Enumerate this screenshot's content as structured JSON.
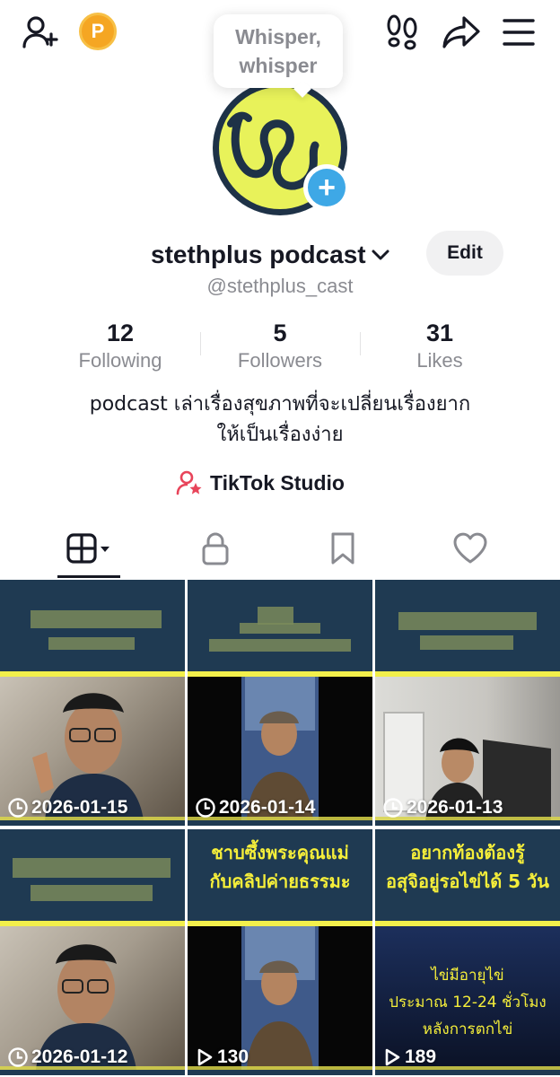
{
  "tooltip": {
    "line1": "Whisper,",
    "line2": "whisper"
  },
  "coin_letter": "P",
  "profile": {
    "username": "stethplus podcast",
    "handle": "@stethplus_cast",
    "edit_label": "Edit",
    "bio_line1": "podcast เล่าเรื่องสุขภาพที่จะเปลี่ยนเรื่องยาก",
    "bio_line2": "ให้เป็นเรื่องง่าย",
    "studio_label": "TikTok Studio"
  },
  "stats": [
    {
      "value": "12",
      "label": "Following"
    },
    {
      "value": "5",
      "label": "Followers"
    },
    {
      "value": "31",
      "label": "Likes"
    }
  ],
  "tabs": [
    {
      "icon": "grid-icon",
      "active": true
    },
    {
      "icon": "lock-icon",
      "active": false
    },
    {
      "icon": "bookmark-icon",
      "active": false
    },
    {
      "icon": "heart-icon",
      "active": false
    }
  ],
  "videos": [
    {
      "overlay": "2026-01-15",
      "overlay_icon": "clock-icon",
      "title": ""
    },
    {
      "overlay": "2026-01-14",
      "overlay_icon": "clock-icon",
      "title": ""
    },
    {
      "overlay": "2026-01-13",
      "overlay_icon": "clock-icon",
      "title": ""
    },
    {
      "overlay": "2026-01-12",
      "overlay_icon": "clock-icon",
      "title": ""
    },
    {
      "overlay": "130",
      "overlay_icon": "play-icon",
      "title_line1": "ชาบซึ้งพระคุณแม่",
      "title_line2": "กับคลิปค่ายธรรมะ"
    },
    {
      "overlay": "189",
      "overlay_icon": "play-icon",
      "title_line1": "อยากท้องต้องรู้",
      "title_line2": "อสุจิอยู่รอไข่ได้ 5 วัน",
      "caption1": "ไข่มีอายุไข่",
      "caption2": "ประมาณ 12-24 ชั่วโมง",
      "caption3": "หลังการตกไข่"
    }
  ],
  "colors": {
    "accent_blue": "#3ea8e6",
    "tile_navy": "#1f3a52",
    "tile_yellow": "#f2ef4b",
    "avatar_yellow": "#e8f25a",
    "studio_red": "#e8445a"
  }
}
